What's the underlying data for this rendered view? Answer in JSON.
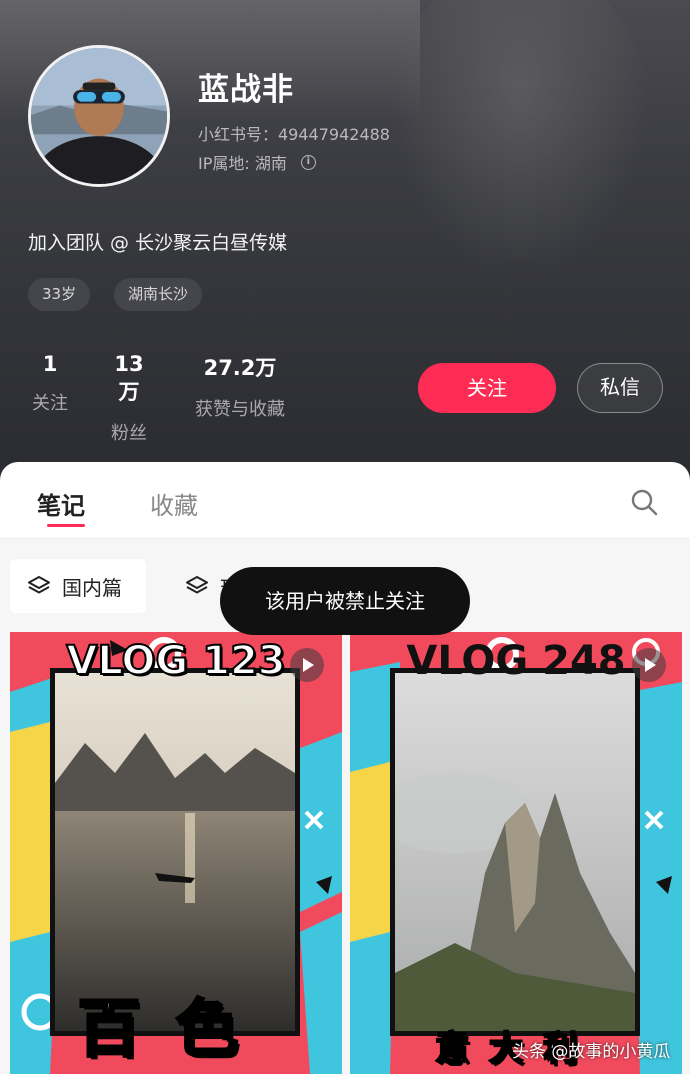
{
  "profile": {
    "name": "蓝战非",
    "user_id": "小红书号：49447942488",
    "ip_location": "IP属地: 湖南",
    "bio": "加入团队 @ 长沙聚云白昼传媒",
    "tags": [
      "33岁",
      "湖南长沙"
    ]
  },
  "stats": [
    {
      "value": "1",
      "label": "关注"
    },
    {
      "value": "13万",
      "label": "粉丝"
    },
    {
      "value": "27.2万",
      "label": "获赞与收藏"
    }
  ],
  "buttons": {
    "follow": "关注",
    "message": "私信"
  },
  "tabs": [
    {
      "label": "笔记",
      "active": true
    },
    {
      "label": "收藏",
      "active": false
    }
  ],
  "filters": [
    {
      "label": "国内篇"
    },
    {
      "label": "玩"
    }
  ],
  "toast": "该用户被禁止关注",
  "cards": [
    {
      "title": "VLOG 123",
      "place": "百色"
    },
    {
      "title": "VLOG 248",
      "place": "意大利"
    }
  ],
  "watermark": "头条 @故事的小黄瓜",
  "colors": {
    "accent": "#fe2c55",
    "header_bg": "#34353a",
    "card_red": "#f24a5d",
    "card_cyan": "#3fc6de",
    "card_yellow": "#f7d548"
  },
  "icons": [
    "info-icon",
    "search-icon",
    "layers-icon",
    "play-icon"
  ]
}
